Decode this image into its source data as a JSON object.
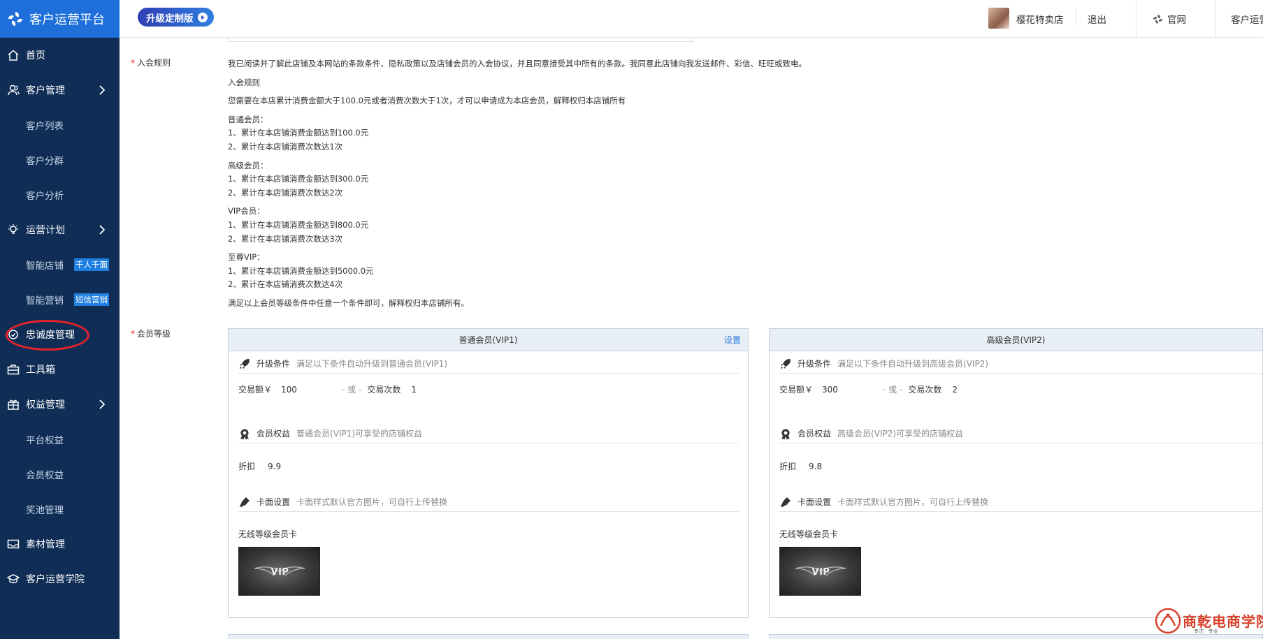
{
  "brand": {
    "title": "客户运营平台"
  },
  "sidebar": {
    "items": [
      {
        "label": "首页",
        "type": "main",
        "icon": "home-icon"
      },
      {
        "label": "客户管理",
        "type": "main",
        "icon": "users-icon",
        "chevron": true
      },
      {
        "label": "客户列表",
        "type": "sub"
      },
      {
        "label": "客户分群",
        "type": "sub"
      },
      {
        "label": "客户分析",
        "type": "sub"
      },
      {
        "label": "运营计划",
        "type": "main",
        "icon": "bulb-icon",
        "chevron": true
      },
      {
        "label": "智能店铺",
        "type": "sub",
        "tag": "千人千面"
      },
      {
        "label": "智能营销",
        "type": "sub",
        "tag": "短信营销"
      },
      {
        "label": "忠诚度管理",
        "type": "main",
        "icon": "loyalty-icon"
      },
      {
        "label": "工具箱",
        "type": "main",
        "icon": "toolbox-icon"
      },
      {
        "label": "权益管理",
        "type": "main",
        "icon": "gift-icon",
        "chevron": true
      },
      {
        "label": "平台权益",
        "type": "sub"
      },
      {
        "label": "会员权益",
        "type": "sub"
      },
      {
        "label": "奖池管理",
        "type": "sub"
      },
      {
        "label": "素材管理",
        "type": "main",
        "icon": "mail-icon"
      },
      {
        "label": "客户运营学院",
        "type": "main",
        "icon": "academy-icon"
      }
    ]
  },
  "header": {
    "upgrade_label": "升级定制版",
    "shop_name": "樱花特卖店",
    "logout": "退出",
    "site": "官网",
    "more": "客户运营"
  },
  "form": {
    "rules_label": "入会规则",
    "rules_lines": [
      "我已阅读并了解此店铺及本网站的条款条件、隐私政策以及店铺会员的入会协议，并且同意接受其中所有的条款。我同意此店铺向我发送邮件、彩信、旺旺或致电。",
      "入会规则",
      "您需要在本店累计消费金额大于100.0元或者消费次数大于1次，才可以申请成为本店会员，解释权归本店铺所有",
      "普通会员：",
      "1、累计在本店铺消费金额达到100.0元",
      "2、累计在本店铺消费次数达1次",
      "高级会员：",
      "1、累计在本店铺消费金额达到300.0元",
      "2、累计在本店铺消费次数达2次",
      "VIP会员：",
      "1、累计在本店铺消费金额达到800.0元",
      "2、累计在本店铺消费次数达3次",
      "至尊VIP：",
      "1、累计在本店铺消费金额达到5000.0元",
      "2、累计在本店铺消费次数达4次",
      "满足以上会员等级条件中任意一个条件即可，解释权归本店铺所有。"
    ],
    "level_label": "会员等级"
  },
  "cards": [
    {
      "title": "普通会员(VIP1)",
      "set_label": "设置",
      "upgrade_title": "升级条件",
      "upgrade_desc": "满足以下条件自动升级到普通会员(VIP1)",
      "amount_label": "交易额￥",
      "amount_value": "100",
      "or_label": "- 或 -",
      "count_label": "交易次数",
      "count_value": "1",
      "benefit_title": "会员权益",
      "benefit_desc": "普通会员(VIP1)可享受的店铺权益",
      "discount_label": "折扣",
      "discount_value": "9.9",
      "cardface_title": "卡面设置",
      "cardface_desc": "卡面样式默认官方图片，可自行上传替换",
      "card_name": "无线等级会员卡",
      "vip_text": "VIP"
    },
    {
      "title": "高级会员(VIP2)",
      "set_label": "",
      "upgrade_title": "升级条件",
      "upgrade_desc": "满足以下条件自动升级到高级会员(VIP2)",
      "amount_label": "交易额￥",
      "amount_value": "300",
      "or_label": "- 或 -",
      "count_label": "交易次数",
      "count_value": "2",
      "benefit_title": "会员权益",
      "benefit_desc": "高级会员(VIP2)可享受的店铺权益",
      "discount_label": "折扣",
      "discount_value": "9.8",
      "cardface_title": "卡面设置",
      "cardface_desc": "卡面样式默认官方图片，可自行上传替换",
      "card_name": "无线等级会员卡",
      "vip_text": "VIP"
    }
  ],
  "watermark": {
    "text": "商乾电商学院",
    "sub": "专注 · 专业"
  },
  "colors": {
    "sidebar_bg": "#0f2d55",
    "brand_bg": "#1e6fd9",
    "accent": "#2b7be0",
    "highlight_ring": "#e8232b"
  }
}
